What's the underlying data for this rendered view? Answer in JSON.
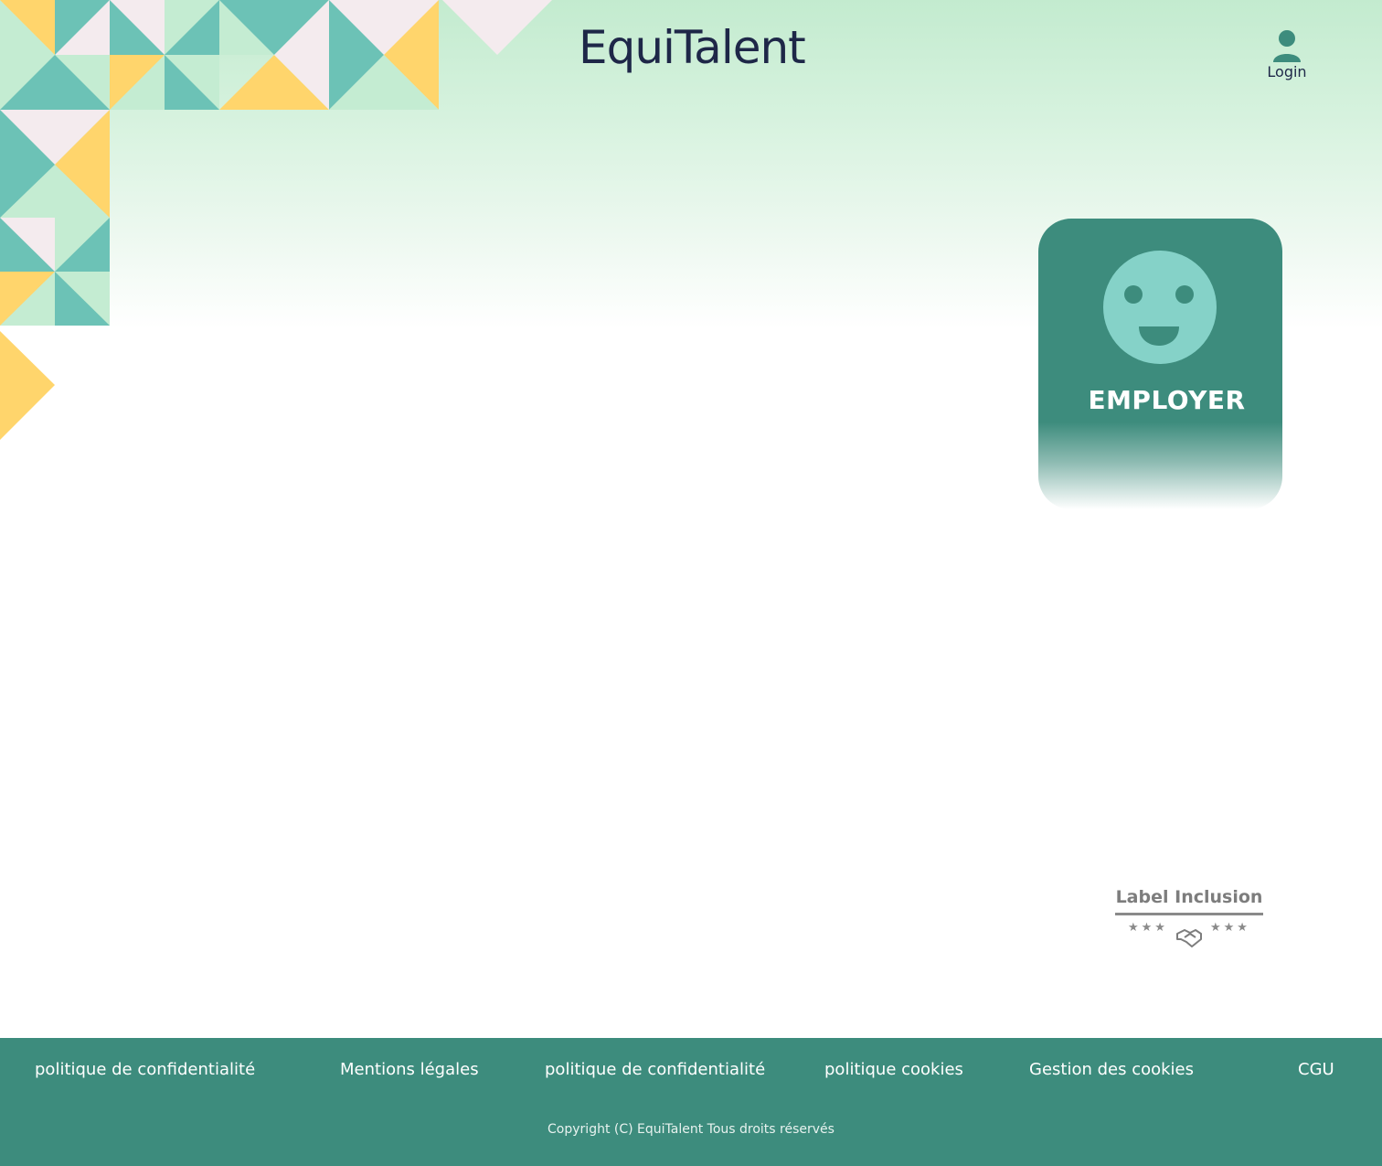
{
  "header": {
    "brand": "EquiTalent",
    "login_label": "Login",
    "login_icon": "user-icon"
  },
  "main": {
    "employer_card": {
      "label": "EMPLOYER",
      "icon": "smiley-face-icon"
    },
    "inclusion_label": {
      "title": "Label Inclusion",
      "stars_left": "★★★",
      "stars_right": "★★★",
      "icon": "handshake-icon"
    }
  },
  "footer": {
    "links": [
      "politique de confidentialité",
      "Mentions légales",
      "politique de confidentialité",
      "politique cookies",
      "Gestion des cookies",
      "CGU"
    ],
    "copyright": "Copyright (C) EquiTalent Tous droits réservés"
  },
  "colors": {
    "teal_dark": "#3d8c7d",
    "teal": "#6cc2b6",
    "mint": "#c4ecd2",
    "yellow": "#ffd56c",
    "blush": "#f4ebee",
    "navy": "#1e2748"
  }
}
